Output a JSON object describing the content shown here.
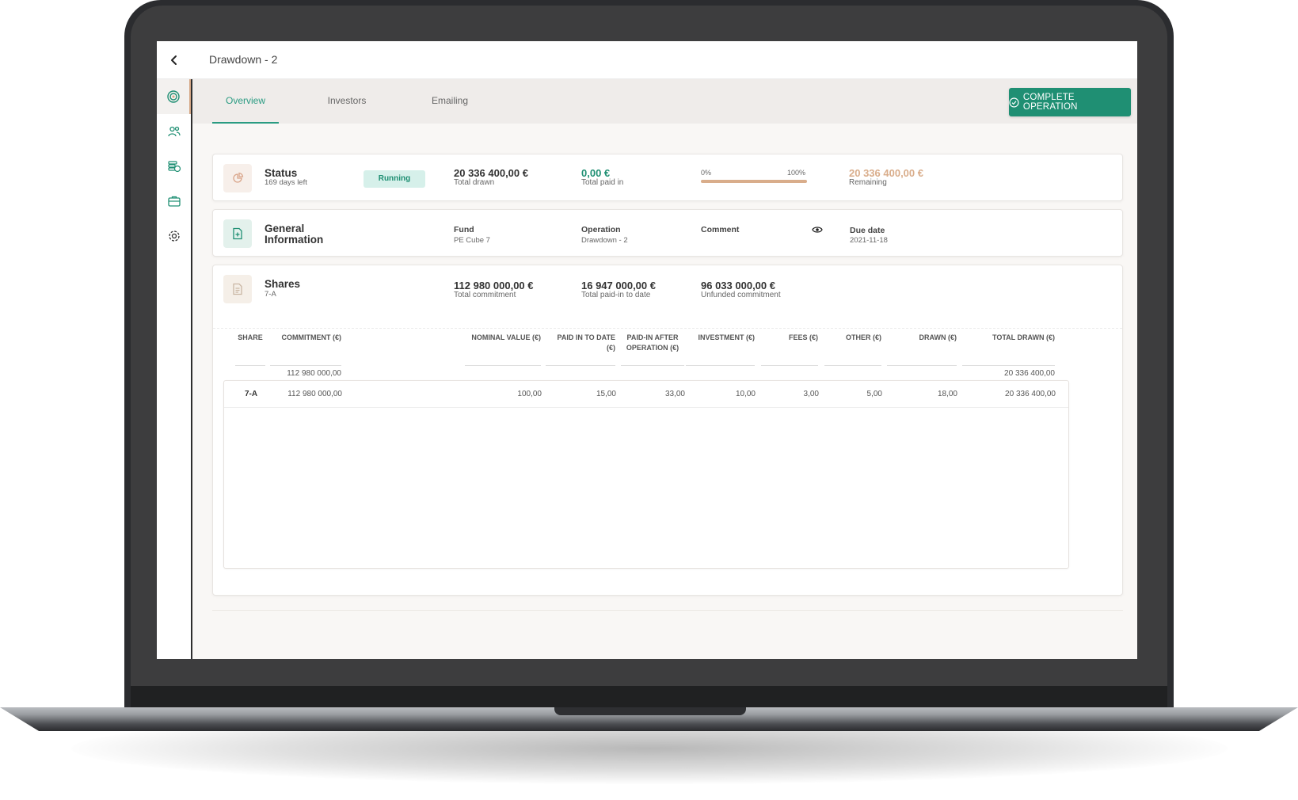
{
  "header": {
    "title": "Drawdown - 2"
  },
  "tabs": [
    "Overview",
    "Investors",
    "Emailing"
  ],
  "actions": {
    "complete_label": "COMPLETE OPERATION"
  },
  "status_card": {
    "title": "Status",
    "days_left": "169 days left",
    "badge": "Running",
    "total_drawn_value": "20 336 400,00 €",
    "total_drawn_label": "Total drawn",
    "paid_in_value": "0,00 €",
    "paid_in_label": "Total paid in",
    "progress_start": "0%",
    "progress_end": "100%",
    "progress_fraction": 0,
    "remaining_value": "20 336 400,00 €",
    "remaining_label": "Remaining"
  },
  "general_card": {
    "title_line1": "General",
    "title_line2": "Information",
    "fund_label": "Fund",
    "fund_value": "PE Cube 7",
    "operation_label": "Operation",
    "operation_value": "Drawdown - 2",
    "comment_label": "Comment",
    "due_label": "Due date",
    "due_value": "2021-11-18"
  },
  "shares_card": {
    "title": "Shares",
    "subtitle": "7-A",
    "total_commitment_value": "112 980 000,00 €",
    "total_commitment_label": "Total commitment",
    "paid_to_date_value": "16 947 000,00 €",
    "paid_to_date_label": "Total paid-in to date",
    "unfunded_value": "96 033 000,00 €",
    "unfunded_label": "Unfunded commitment"
  },
  "table": {
    "headers": {
      "share": "SHARE",
      "commitment": "COMMITMENT (€)",
      "nominal": "NOMINAL VALUE (€)",
      "paid_to_date_l1": "PAID IN TO DATE",
      "paid_to_date_l2": "(€)",
      "paid_after_l1": "PAID-IN AFTER",
      "paid_after_l2": "OPERATION (€)",
      "investment": "INVESTMENT (€)",
      "fees": "FEES (€)",
      "other": "OTHER (€)",
      "drawn": "DRAWN (€)",
      "total_drawn": "TOTAL DRAWN (€)"
    },
    "totals": {
      "commitment": "112 980 000,00",
      "total_drawn": "20 336 400,00"
    },
    "rows": [
      {
        "share": "7-A",
        "commitment": "112 980 000,00",
        "nominal": "100,00",
        "paid_to_date": "15,00",
        "paid_after": "33,00",
        "investment": "10,00",
        "fees": "3,00",
        "other": "5,00",
        "drawn": "18,00",
        "total_drawn": "20 336 400,00"
      }
    ]
  },
  "colors": {
    "accent": "#1f8f73",
    "accent_light": "#d6f0ea",
    "remaining": "#d9ad8b",
    "paid_in": "#1f8f73"
  },
  "icons": [
    "chevron-left-icon",
    "target-icon",
    "users-icon",
    "coins-icon",
    "briefcase-icon",
    "gear-icon",
    "pie-chart-icon",
    "file-plus-icon",
    "document-icon",
    "eye-icon",
    "check-circle-icon"
  ]
}
